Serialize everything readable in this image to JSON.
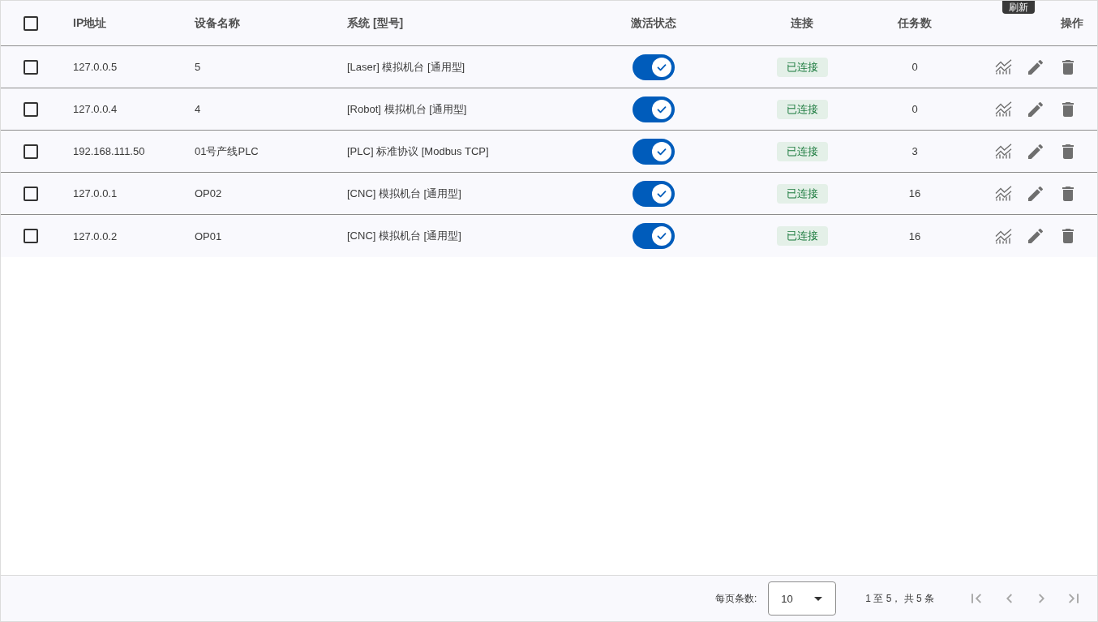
{
  "table": {
    "select_all": {
      "checked": false
    },
    "columns": [
      "IP地址",
      "设备名称",
      "系统 [型号]",
      "激活状态",
      "连接",
      "任务数",
      "操作"
    ],
    "rows": [
      {
        "checked": false,
        "ip": "127.0.0.5",
        "name": "5",
        "system": "[Laser] 模拟机台 [通用型]",
        "active": true,
        "connection": "已连接",
        "tasks": "0"
      },
      {
        "checked": false,
        "ip": "127.0.0.4",
        "name": "4",
        "system": "[Robot] 模拟机台 [通用型]",
        "active": true,
        "connection": "已连接",
        "tasks": "0"
      },
      {
        "checked": false,
        "ip": "192.168.111.50",
        "name": "01号产线PLC",
        "system": "[PLC] 标准协议 [Modbus TCP]",
        "active": true,
        "connection": "已连接",
        "tasks": "3"
      },
      {
        "checked": false,
        "ip": "127.0.0.1",
        "name": "OP02",
        "system": "[CNC] 模拟机台 [通用型]",
        "active": true,
        "connection": "已连接",
        "tasks": "16"
      },
      {
        "checked": false,
        "ip": "127.0.0.2",
        "name": "OP01",
        "system": "[CNC] 模拟机台 [通用型]",
        "active": true,
        "connection": "已连接",
        "tasks": "16"
      }
    ]
  },
  "tooltip": {
    "text": "刷新"
  },
  "pagination": {
    "page_size_label": "每页条数:",
    "page_size": "10",
    "range": "1 至 5， 共 5 条",
    "buttons": [
      {
        "kind": "first",
        "disabled": true
      },
      {
        "kind": "prev",
        "disabled": true
      },
      {
        "kind": "next",
        "disabled": true
      },
      {
        "kind": "last",
        "disabled": true
      }
    ]
  }
}
